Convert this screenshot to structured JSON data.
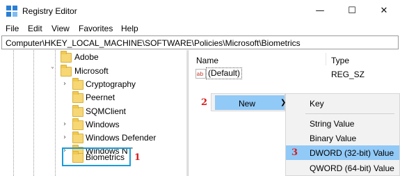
{
  "window": {
    "title": "Registry Editor",
    "minimize_glyph": "—",
    "maximize_glyph": "☐",
    "close_glyph": "✕"
  },
  "menu": [
    "File",
    "Edit",
    "View",
    "Favorites",
    "Help"
  ],
  "address": "Computer\\HKEY_LOCAL_MACHINE\\SOFTWARE\\Policies\\Microsoft\\Biometrics",
  "tree": {
    "items": [
      {
        "label": "Adobe",
        "expander": "",
        "level": 1
      },
      {
        "label": "Microsoft",
        "expander": "v",
        "level": 1
      },
      {
        "label": "Cryptography",
        "expander": ">",
        "level": 2
      },
      {
        "label": "Peernet",
        "expander": "",
        "level": 2
      },
      {
        "label": "SQMClient",
        "expander": "",
        "level": 2
      },
      {
        "label": "Windows",
        "expander": ">",
        "level": 2
      },
      {
        "label": "Windows Defender",
        "expander": ">",
        "level": 2
      },
      {
        "label": "Windows NT",
        "expander": ">",
        "level": 2
      },
      {
        "label": "Biometrics",
        "expander": "",
        "level": 2,
        "selected": true
      }
    ]
  },
  "list": {
    "columns": [
      "Name",
      "Type"
    ],
    "rows": [
      {
        "icon": "ab",
        "name": "(Default)",
        "type": "REG_SZ"
      }
    ]
  },
  "context_menu": {
    "items": [
      {
        "label": "New",
        "arrow": ">",
        "highlighted": true
      }
    ]
  },
  "submenu": {
    "items": [
      {
        "label": "Key",
        "highlighted": false
      },
      {
        "label": "String Value",
        "highlighted": false
      },
      {
        "label": "Binary Value",
        "highlighted": false
      },
      {
        "label": "DWORD (32-bit) Value",
        "highlighted": true
      },
      {
        "label": "QWORD (64-bit) Value",
        "highlighted": false
      }
    ]
  },
  "annotations": {
    "step1": "1",
    "step2": "2",
    "step3": "3",
    "color": "#d81e1e"
  },
  "colors": {
    "highlight": "#91c9f7",
    "selection_border": "#1b9bd8",
    "folder": "#f7d774"
  }
}
